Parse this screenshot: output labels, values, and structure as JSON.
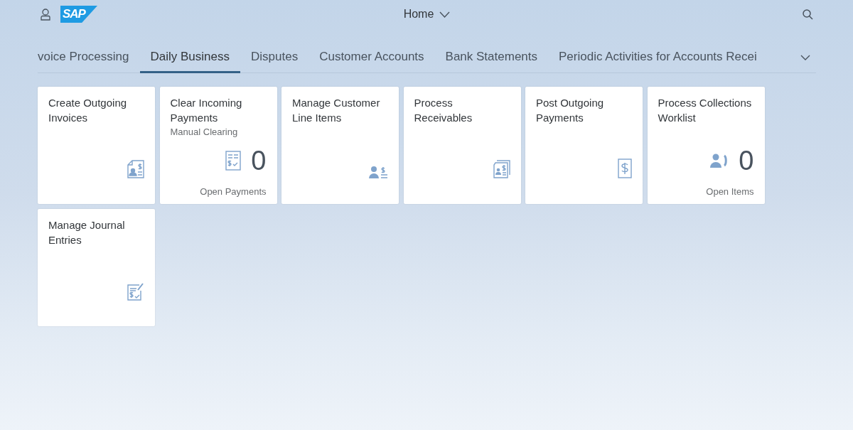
{
  "header": {
    "logo": "SAP",
    "title": "Home"
  },
  "tabs": [
    {
      "label": "voice Processing",
      "selected": false
    },
    {
      "label": "Daily Business",
      "selected": true
    },
    {
      "label": "Disputes",
      "selected": false
    },
    {
      "label": "Customer Accounts",
      "selected": false
    },
    {
      "label": "Bank Statements",
      "selected": false
    },
    {
      "label": "Periodic Activities for Accounts Recei",
      "selected": false
    }
  ],
  "tiles": [
    {
      "title": "Create Outgoing Invoices"
    },
    {
      "title": "Clear Incoming Payments",
      "subtitle": "Manual Clearing",
      "number": "0",
      "footer": "Open Payments"
    },
    {
      "title": "Manage Customer Line Items"
    },
    {
      "title": "Process Receivables"
    },
    {
      "title": "Post Outgoing Payments"
    },
    {
      "title": "Process Collections Worklist",
      "number": "0",
      "footer": "Open Items"
    },
    {
      "title": "Manage Journal Entries"
    }
  ]
}
